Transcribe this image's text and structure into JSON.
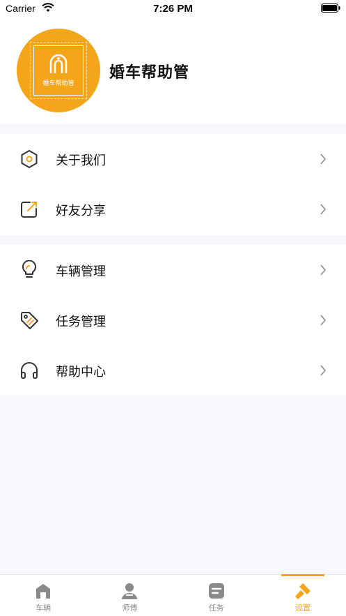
{
  "status_bar": {
    "carrier": "Carrier",
    "time": "7:26 PM"
  },
  "profile": {
    "app_name": "婚车帮助管",
    "logo_text": "婚车帮助管",
    "avatar_color": "#f5a519"
  },
  "menu_groups": [
    {
      "items": [
        {
          "label": "关于我们",
          "icon": "hexagon-icon"
        },
        {
          "label": "好友分享",
          "icon": "share-icon"
        }
      ]
    },
    {
      "items": [
        {
          "label": "车辆管理",
          "icon": "lightbulb-icon"
        },
        {
          "label": "任务管理",
          "icon": "tag-icon"
        },
        {
          "label": "帮助中心",
          "icon": "headphones-icon"
        }
      ]
    }
  ],
  "tab_bar": {
    "accent": "#f5a519",
    "tabs": [
      {
        "label": "车辆",
        "icon": "home-icon",
        "active": false
      },
      {
        "label": "师傅",
        "icon": "person-icon",
        "active": false
      },
      {
        "label": "任务",
        "icon": "task-icon",
        "active": false
      },
      {
        "label": "设置",
        "icon": "hammer-icon",
        "active": true
      }
    ]
  }
}
